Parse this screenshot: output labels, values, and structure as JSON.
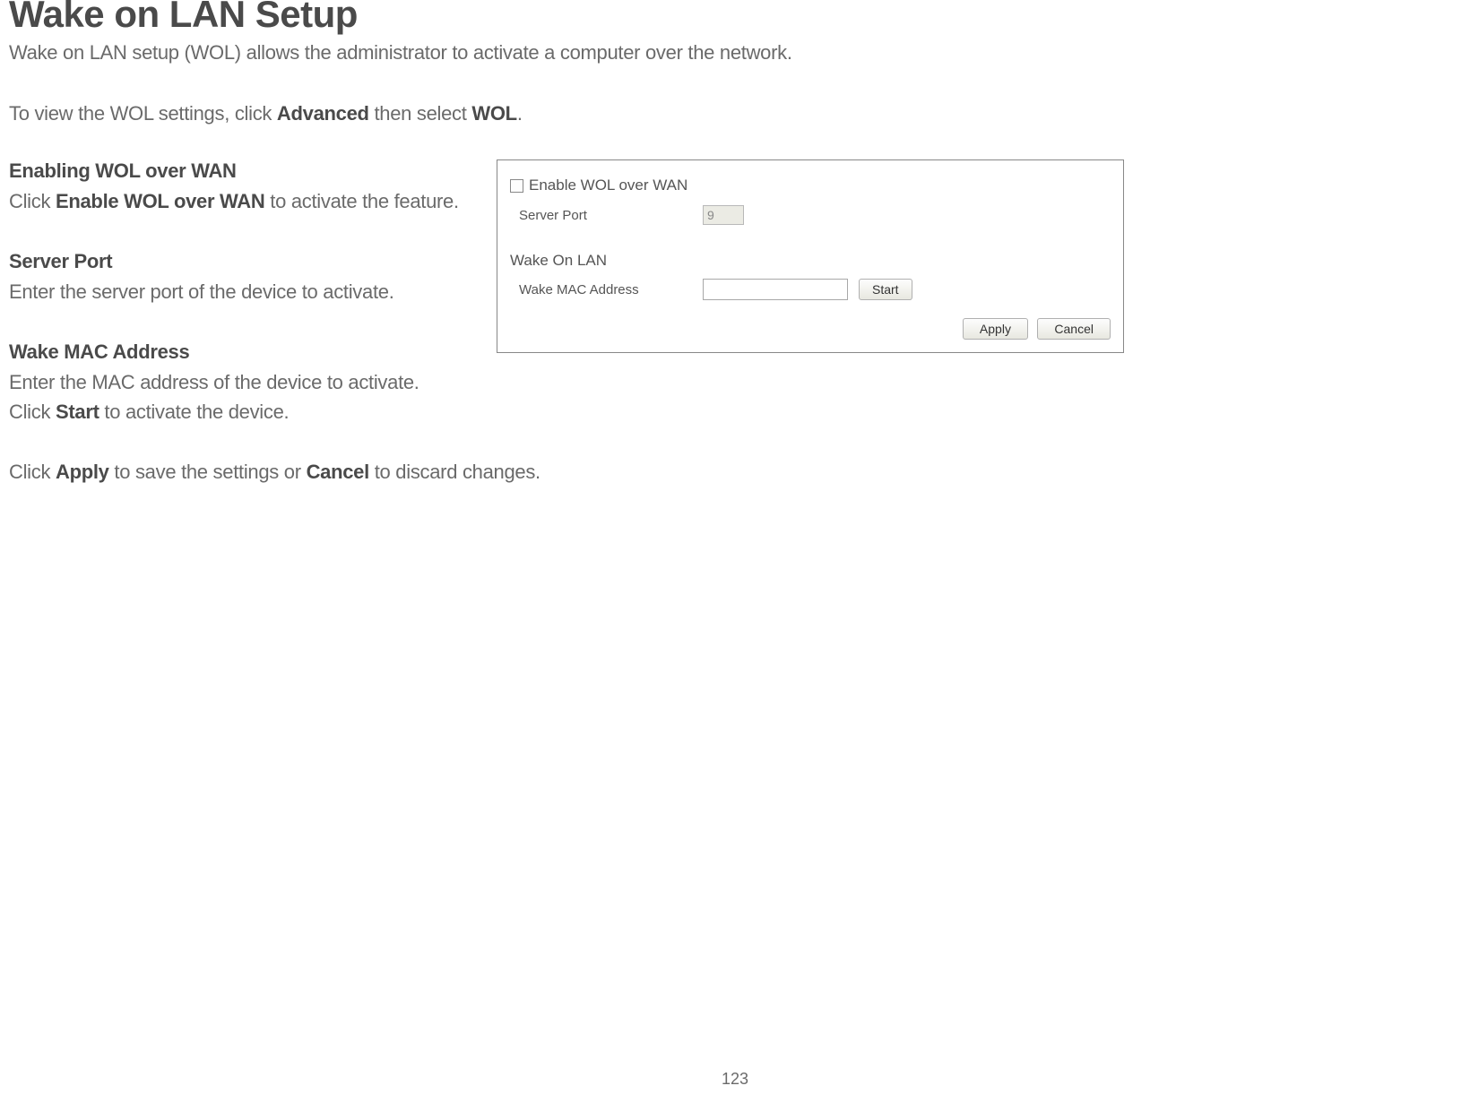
{
  "title": "Wake on LAN Setup",
  "intro": "Wake on LAN setup (WOL) allows the administrator to activate a computer over the network.",
  "nav_pre": "To view the WOL settings, click ",
  "nav_b1": "Advanced",
  "nav_mid": " then select ",
  "nav_b2": "WOL",
  "nav_post": ".",
  "sec1_title": "Enabling WOL over WAN",
  "sec1_pre": "Click ",
  "sec1_b": "Enable WOL over WAN",
  "sec1_post": " to activate the feature.",
  "sec2_title": "Server Port",
  "sec2_text": "Enter the server port of the device to activate.",
  "sec3_title": "Wake MAC Address",
  "sec3_line1": "Enter the MAC address of the device to activate.",
  "sec3_pre": "Click ",
  "sec3_b": "Start",
  "sec3_post": " to activate the device.",
  "final_pre": "Click ",
  "final_b1": "Apply",
  "final_mid": " to save the settings or ",
  "final_b2": "Cancel",
  "final_post": " to discard changes.",
  "panel": {
    "enable_label": "Enable WOL over WAN",
    "server_port_label": "Server Port",
    "server_port_value": "9",
    "wol_header": "Wake On LAN",
    "mac_label": "Wake MAC Address",
    "mac_value": "",
    "start_btn": "Start",
    "apply_btn": "Apply",
    "cancel_btn": "Cancel"
  },
  "page_number": "123"
}
